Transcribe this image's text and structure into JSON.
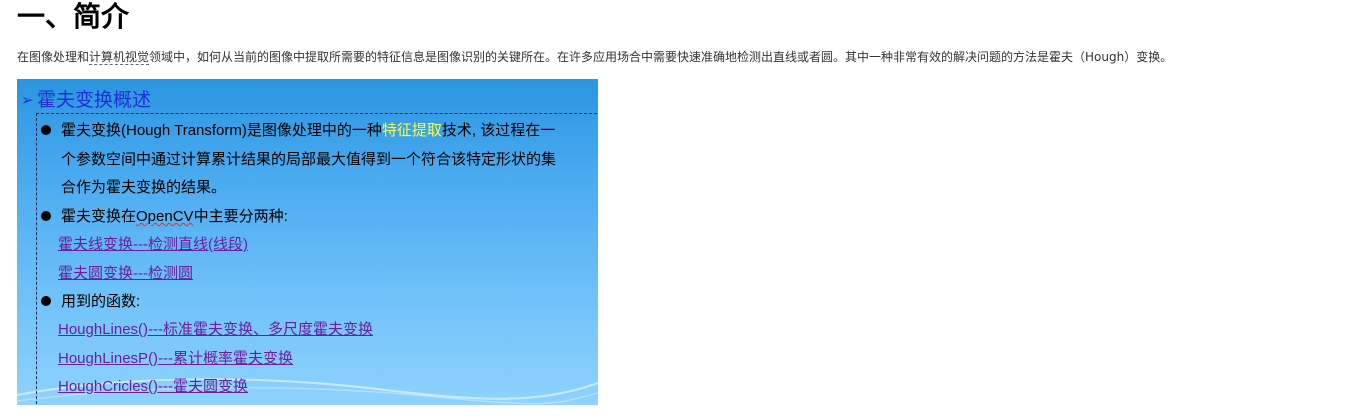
{
  "heading": "一、简介",
  "intro": {
    "part1": "在图像处理和",
    "keyword": "计算机视觉",
    "part2": "领域中，如何从当前的图像中提取所需要的特征信息是图像识别的关键所在。在许多应用场合中需要快速准确地检测出直线或者圆。其中一种非常有效的解决问题的方法是霍夫（Hough）变换。"
  },
  "panel": {
    "arrow_glyph": "➢",
    "title": "霍夫变换概述",
    "bullet1": {
      "line1_a": "霍夫变换(Hough Transform)是图像处理中的一种",
      "line1_highlight": "特征提取",
      "line1_b": "技术, 该过程在一",
      "line2": "个参数空间中通过计算累计结果的局部最大值得到一个符合该特定形状的集",
      "line3": "合作为霍夫变换的结果。"
    },
    "bullet2": {
      "a": "霍夫变换在",
      "opencv": "OpenCV",
      "b": "中主要分两种:"
    },
    "transforms": [
      "霍夫线变换---检测直线(线段)",
      "霍夫圆变换---检测圆"
    ],
    "bullet3": "用到的函数:",
    "functions": [
      {
        "name": "HoughLines()",
        "desc": "---标准霍夫变换、多尺度霍夫变换"
      },
      {
        "name": "HoughLinesP()",
        "desc": "---累计概率霍夫变换"
      },
      {
        "name": "HoughCricles()",
        "desc": "---霍夫圆变换"
      }
    ],
    "colors": {
      "title": "#1f2fd6",
      "highlight": "#ffff3a",
      "link": "#6a1fa0",
      "background_top": "#2a95e0",
      "background_bottom": "#8fd2fd"
    }
  }
}
